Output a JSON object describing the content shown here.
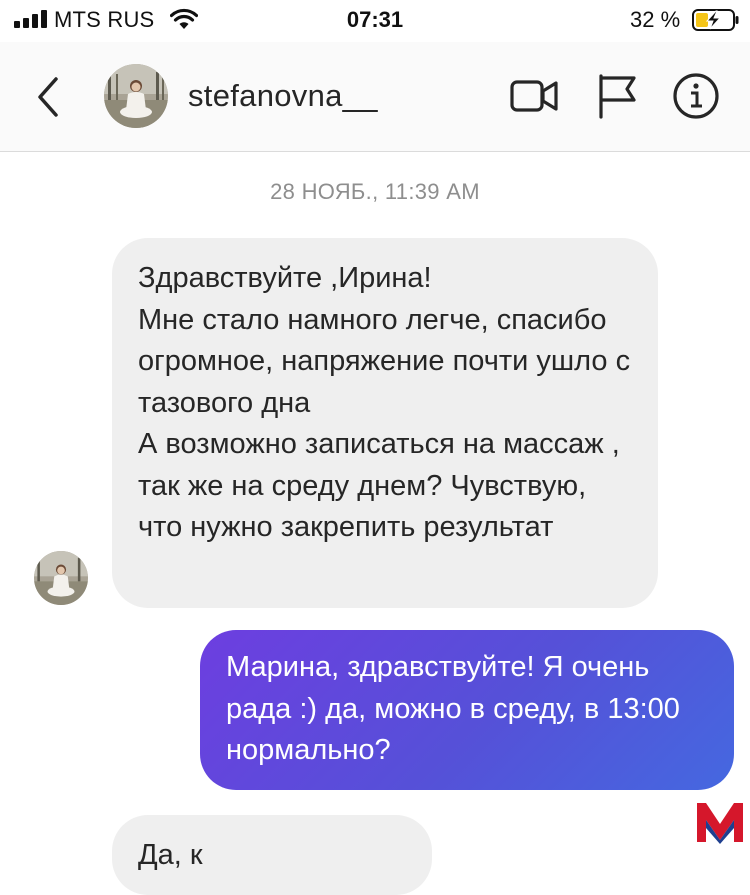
{
  "status_bar": {
    "carrier": "MTS RUS",
    "time": "07:31",
    "battery_percent": "32 %"
  },
  "header": {
    "username": "stefanovna__"
  },
  "conversation": {
    "timestamp": "28 НОЯБ., 11:39 AM",
    "incoming_message_1": {
      "paragraphs": [
        "Здравствуйте ,Ирина!",
        "Мне стало намного легче, спасибо огромное, напряжение почти ушло с тазового дна",
        "А возможно записаться на массаж , так же на среду днем? Чувствую, что нужно закрепить результат"
      ]
    },
    "outgoing_message_1": {
      "text": "Марина, здравствуйте! Я очень рада :) да, можно в среду, в 13:00 нормально?"
    },
    "incoming_message_2": {
      "text": "Да, к "
    }
  },
  "colors": {
    "outgoing_start": "#6d3ee0",
    "outgoing_end": "#4568e0",
    "incoming_bg": "#efefef",
    "logo_red": "#d5172b"
  },
  "icons": [
    "signal-icon",
    "wifi-icon",
    "battery-charging-icon",
    "back-chevron-icon",
    "video-call-icon",
    "flag-icon",
    "info-icon"
  ]
}
